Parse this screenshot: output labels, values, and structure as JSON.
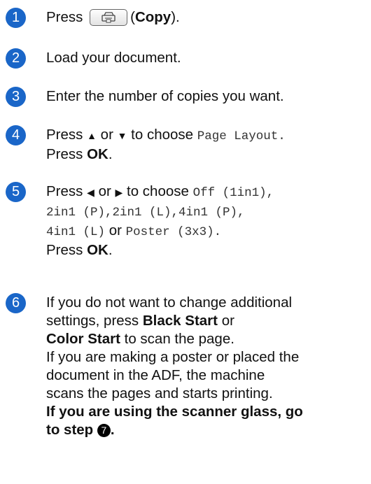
{
  "steps": [
    {
      "num": "1",
      "press": "Press",
      "paren_open": "(",
      "copy_label": "Copy",
      "paren_close": ").",
      "key_icon": "copy-machine-icon"
    },
    {
      "num": "2",
      "text": "Load your document."
    },
    {
      "num": "3",
      "text": "Enter the number of copies you want."
    },
    {
      "num": "4",
      "press": "Press",
      "up": "▲",
      "or": "or",
      "down": "▼",
      "to_choose": "to choose",
      "option": "Page Layout.",
      "press2": "Press",
      "ok": "OK",
      "period": "."
    },
    {
      "num": "5",
      "press": "Press",
      "left": "◀",
      "or": "or",
      "right": "▶",
      "to_choose": "to choose",
      "opt1": "Off (1in1),",
      "opt2": "2in1 (P),",
      "opt3": "2in1 (L),",
      "opt4": "4in1 (P),",
      "opt5": "4in1 (L)",
      "or2": "or",
      "opt6": "Poster (3x3).",
      "press2": "Press",
      "ok": "OK",
      "period": "."
    },
    {
      "num": "6",
      "l1": "If you do not want to change additional",
      "l2a": "settings, press",
      "l2b": "Black Start",
      "l2c": "or",
      "l3a": "Color Start",
      "l3b": "to scan the page.",
      "l4": "If you are making a poster or placed the",
      "l5": "document in the ADF, the machine",
      "l6": "scans the pages and starts printing.",
      "l7": "If you are using the scanner glass, go",
      "l8a": "to step",
      "l8b": "7",
      "l8c": "."
    }
  ]
}
